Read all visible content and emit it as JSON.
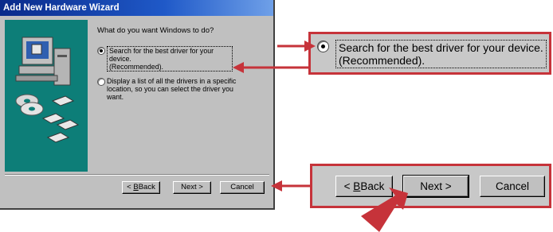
{
  "window": {
    "title": "Add New Hardware Wizard"
  },
  "wizard": {
    "prompt": "What do you want Windows to do?",
    "option_search": {
      "line1": "Search for the best driver for your device.",
      "line2": "(Recommended)."
    },
    "option_list": {
      "line1": "Display a list of all the drivers in a specific",
      "line2": "location, so you can select the driver you want."
    }
  },
  "buttons": {
    "back_rest": "Back",
    "back_key": "B",
    "back_prefix": "< ",
    "next": "Next >",
    "cancel": "Cancel"
  },
  "zoom_top": {
    "line1": "Search for the best driver for your device.",
    "line2": "(Recommended)."
  },
  "zoom_bottom": {
    "back_rest": "Back",
    "back_key": "B",
    "back_prefix": "< ",
    "next": "Next >",
    "cancel": "Cancel"
  },
  "colors": {
    "title_bar": "#0a2a8a",
    "accent_red": "#c6333a",
    "dialog_face": "#c0c0c0",
    "illustration_teal": "#0d7e78"
  },
  "icons": [
    "computer-icon",
    "cd-disc-icon",
    "floppy-disk-icon"
  ]
}
